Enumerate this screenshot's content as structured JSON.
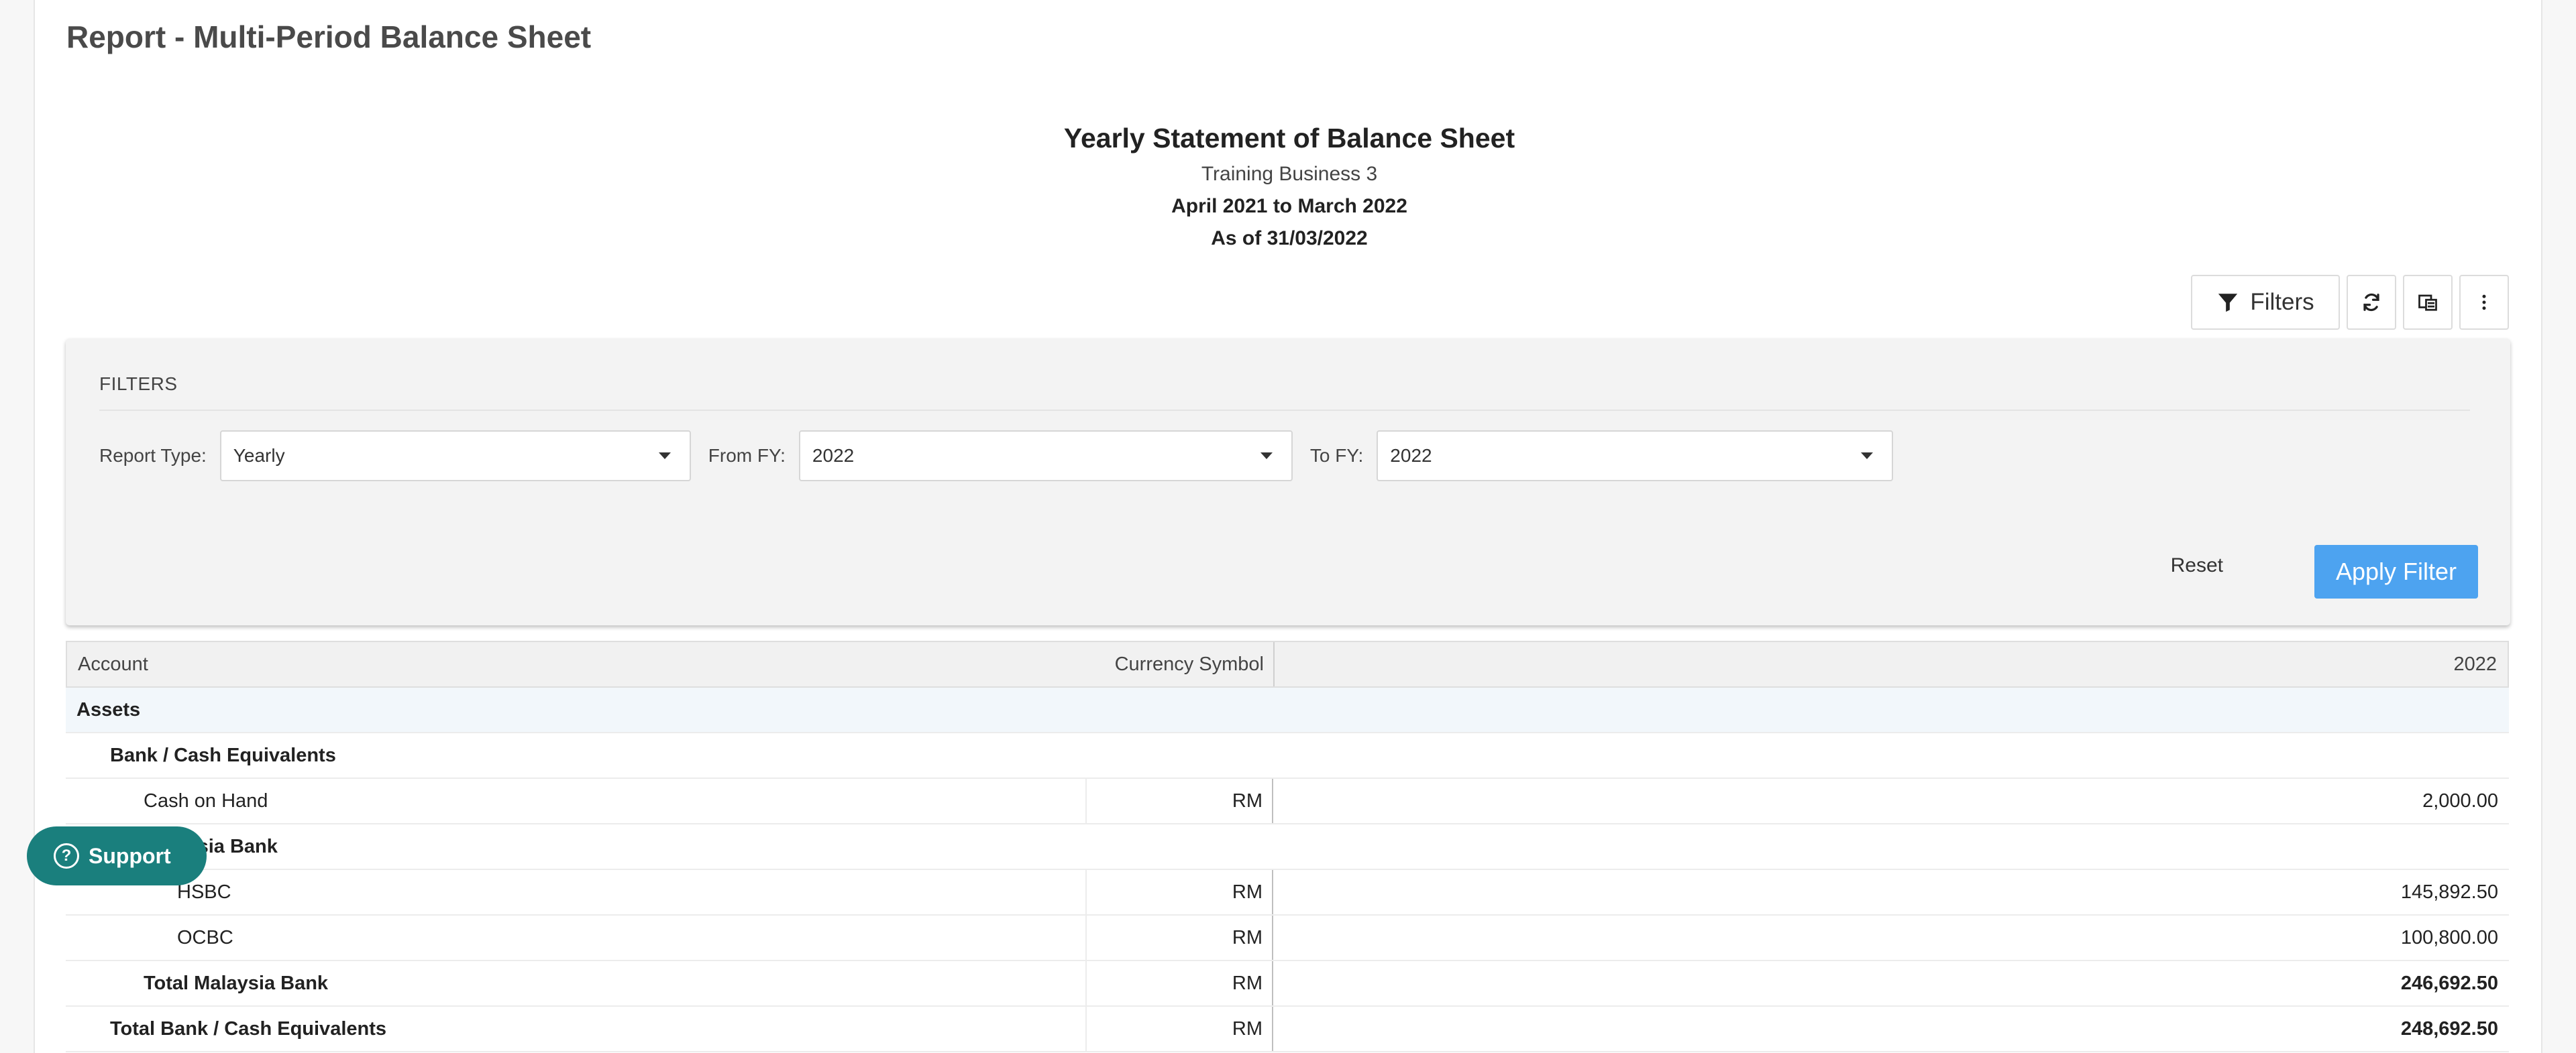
{
  "page_title": "Report - Multi-Period Balance Sheet",
  "report": {
    "title": "Yearly Statement of Balance Sheet",
    "business": "Training Business 3",
    "period": "April 2021 to March 2022",
    "as_of": "As of 31/03/2022"
  },
  "toolbar": {
    "filters_label": "Filters"
  },
  "filters": {
    "heading": "FILTERS",
    "report_type_label": "Report Type:",
    "report_type_value": "Yearly",
    "from_fy_label": "From FY:",
    "from_fy_value": "2022",
    "to_fy_label": "To FY:",
    "to_fy_value": "2022",
    "reset_label": "Reset",
    "apply_label": "Apply Filter"
  },
  "table": {
    "headers": {
      "account": "Account",
      "currency": "Currency Symbol",
      "year": "2022"
    },
    "rows": [
      {
        "account": "Assets",
        "currency": "",
        "value": ""
      },
      {
        "account": "Bank / Cash Equivalents",
        "currency": "",
        "value": ""
      },
      {
        "account": "Cash on Hand",
        "currency": "RM",
        "value": "2,000.00"
      },
      {
        "account": "Malaysia Bank",
        "currency": "",
        "value": ""
      },
      {
        "account": "HSBC",
        "currency": "RM",
        "value": "145,892.50"
      },
      {
        "account": "OCBC",
        "currency": "RM",
        "value": "100,800.00"
      },
      {
        "account": "Total Malaysia Bank",
        "currency": "RM",
        "value": "246,692.50"
      },
      {
        "account": "Total Bank / Cash Equivalents",
        "currency": "RM",
        "value": "248,692.50"
      }
    ]
  },
  "support": {
    "label": "Support"
  },
  "colors": {
    "primary": "#4da3f0",
    "support_bg": "#1a7f7d",
    "assets_row_bg": "#f2f7fb"
  }
}
